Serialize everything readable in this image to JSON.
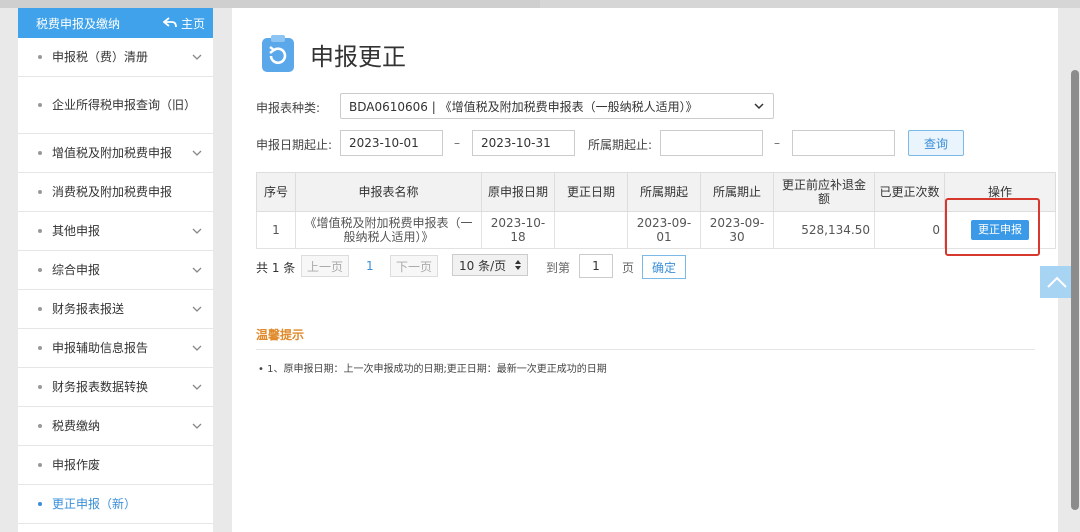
{
  "sidebar": {
    "title": "税费申报及缴纳",
    "home_label": "主页",
    "items": [
      {
        "label": "申报税（费）清册",
        "expandable": true
      },
      {
        "label": "企业所得税申报查询（旧）",
        "expandable": false
      },
      {
        "label": "增值税及附加税费申报",
        "expandable": true
      },
      {
        "label": "消费税及附加税费申报",
        "expandable": false
      },
      {
        "label": "其他申报",
        "expandable": true
      },
      {
        "label": "综合申报",
        "expandable": true
      },
      {
        "label": "财务报表报送",
        "expandable": true
      },
      {
        "label": "申报辅助信息报告",
        "expandable": true
      },
      {
        "label": "财务报表数据转换",
        "expandable": true
      },
      {
        "label": "税费缴纳",
        "expandable": true
      },
      {
        "label": "申报作废",
        "expandable": false
      },
      {
        "label": "更正申报（新）",
        "expandable": false,
        "active": true
      }
    ]
  },
  "page": {
    "title": "申报更正"
  },
  "form": {
    "type_label": "申报表种类:",
    "type_value": "BDA0610606 | 《增值税及附加税费申报表（一般纳税人适用）》",
    "date_label": "申报日期起止:",
    "date_start": "2023-10-01",
    "date_end": "2023-10-31",
    "period_label": "所属期起止:",
    "period_start": "",
    "period_end": "",
    "dash": "–",
    "query_label": "查询"
  },
  "table": {
    "headers": [
      "序号",
      "申报表名称",
      "原申报日期",
      "更正日期",
      "所属期起",
      "所属期止",
      "更正前应补退金额",
      "已更正次数",
      "操作"
    ],
    "rows": [
      {
        "index": "1",
        "name": "《增值税及附加税费申报表（一般纳税人适用）》",
        "orig_date": "2023-10-18",
        "correct_date": "",
        "period_start": "2023-09-01",
        "period_end": "2023-09-30",
        "amount": "528,134.50",
        "count": "0",
        "action": "更正申报"
      }
    ]
  },
  "pager": {
    "total": "共 1 条",
    "prev": "上一页",
    "current": "1",
    "next": "下一页",
    "page_size": "10 条/页",
    "goto_label": "到第",
    "goto_value": "1",
    "page_unit": "页",
    "confirm": "确定"
  },
  "tips": {
    "title": "温馨提示",
    "items": [
      "1、原申报日期：上一次申报成功的日期;更正日期：最新一次更正成功的日期"
    ]
  },
  "colors": {
    "accent": "#3fa2ea",
    "highlight": "#d6382e",
    "tips": "#e08a2b"
  }
}
